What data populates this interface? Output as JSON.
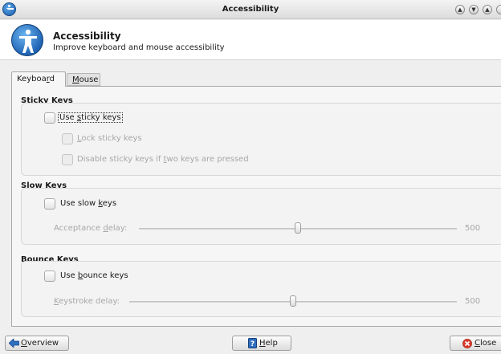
{
  "window": {
    "title": "Accessibility",
    "controls": [
      "up-icon",
      "down-icon",
      "expand-icon"
    ]
  },
  "header": {
    "title": "Accessibility",
    "subtitle": "Improve keyboard and mouse accessibility",
    "icon": "accessibility-icon"
  },
  "tabs": [
    {
      "label_pre": "Keyboa",
      "label_u": "r",
      "label_post": "d",
      "active": true
    },
    {
      "label_pre": "",
      "label_u": "M",
      "label_post": "ouse",
      "active": false
    }
  ],
  "sticky": {
    "title": "Sticky Keys",
    "use": {
      "pre": "Use ",
      "u": "s",
      "post": "ticky keys",
      "checked": false
    },
    "lock": {
      "pre": "",
      "u": "L",
      "post": "ock sticky keys",
      "checked": false
    },
    "disable": {
      "pre": "Disable sticky keys if ",
      "u": "t",
      "post": "wo keys are pressed",
      "checked": false
    }
  },
  "slow": {
    "title": "Slow Keys",
    "use": {
      "pre": "Use slow ",
      "u": "k",
      "post": "eys",
      "checked": false
    },
    "delay": {
      "pre": "Acceptance ",
      "u": "d",
      "post": "elay:",
      "value": "500",
      "fraction": 0.5
    }
  },
  "bounce": {
    "title": "Bounce Keys",
    "use": {
      "pre": "Use ",
      "u": "b",
      "post": "ounce keys",
      "checked": false
    },
    "delay": {
      "pre": "",
      "u": "K",
      "post": "eystroke delay:",
      "value": "500",
      "fraction": 0.5
    }
  },
  "buttons": {
    "overview": {
      "pre": "",
      "u": "O",
      "post": "verview",
      "icon": "back-arrow-icon"
    },
    "help": {
      "pre": "",
      "u": "H",
      "post": "elp",
      "icon": "help-book-icon"
    },
    "close": {
      "pre": "",
      "u": "C",
      "post": "lose",
      "icon": "close-icon"
    }
  },
  "colors": {
    "accent": "#1f63b3",
    "close_red": "#d83a2c"
  }
}
